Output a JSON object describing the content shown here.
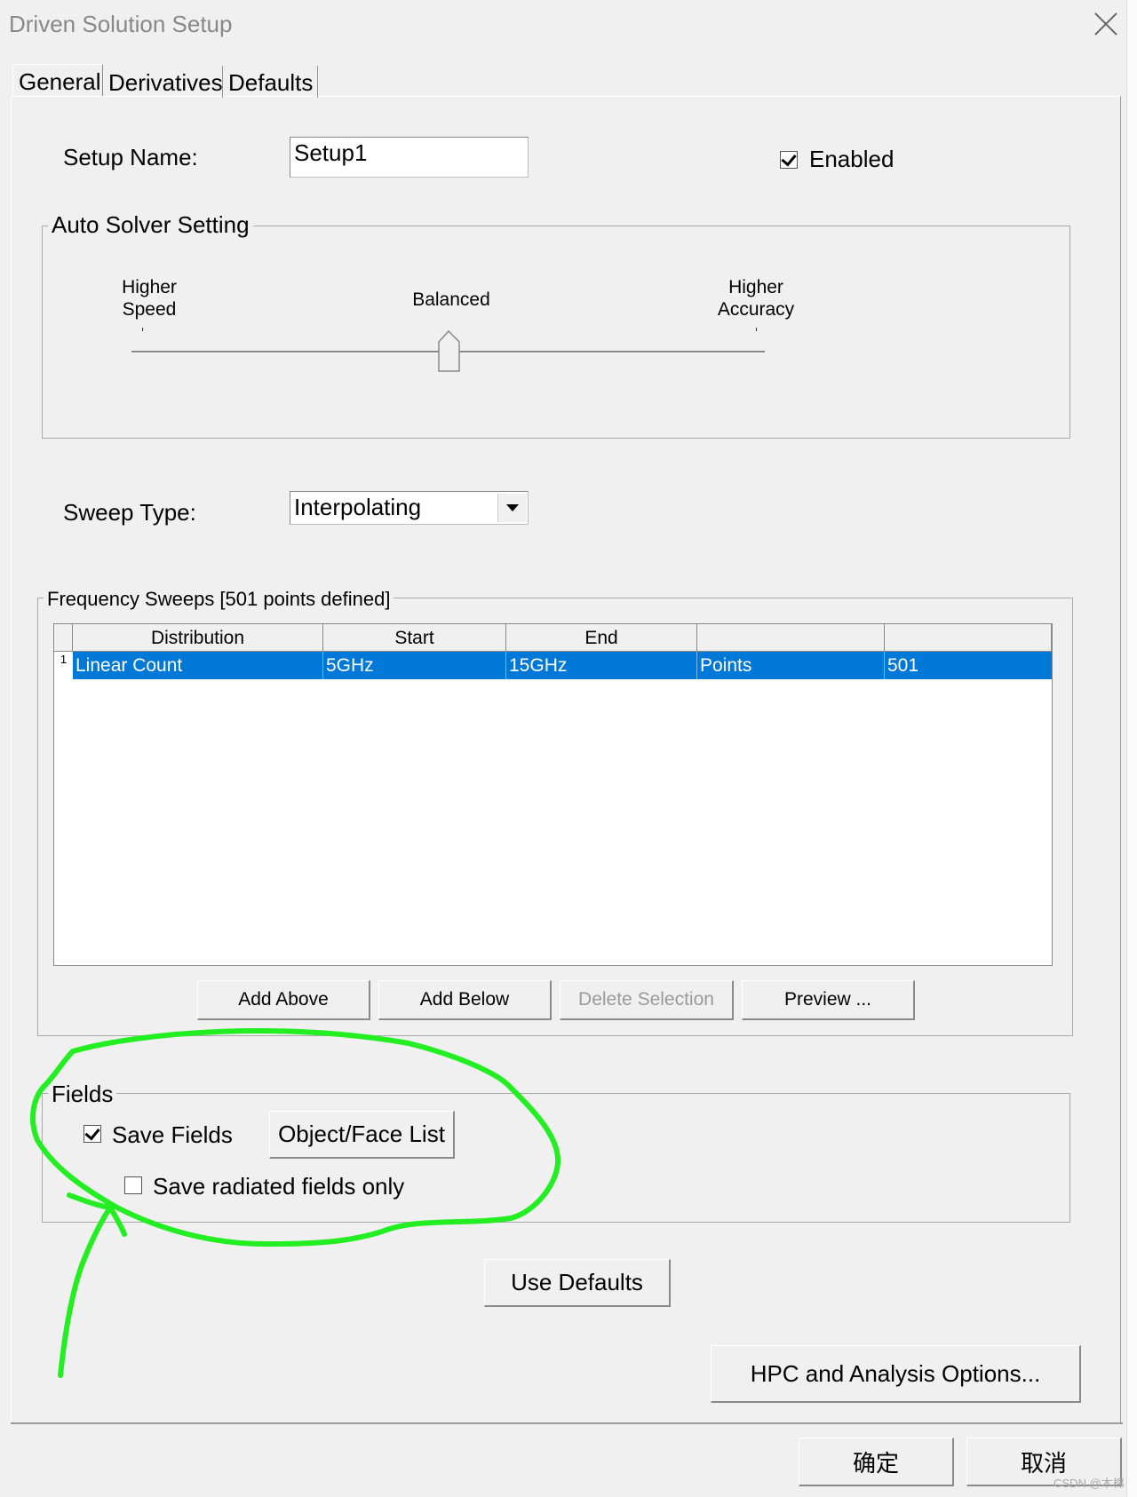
{
  "window": {
    "title": "Driven Solution Setup"
  },
  "tabs": [
    {
      "label": "General",
      "active": true
    },
    {
      "label": "Derivatives",
      "active": false
    },
    {
      "label": "Defaults",
      "active": false
    }
  ],
  "setup_name": {
    "label": "Setup Name:",
    "value": "Setup1"
  },
  "enabled": {
    "label": "Enabled",
    "checked": true
  },
  "auto_solver": {
    "title": "Auto Solver Setting",
    "left_label": "Higher\nSpeed",
    "middle_label": "Balanced",
    "right_label": "Higher\nAccuracy",
    "slider_value": 0.5
  },
  "sweep_type": {
    "label": "Sweep Type:",
    "value": "Interpolating"
  },
  "frequency_sweeps": {
    "title": "Frequency Sweeps [501 points defined]",
    "columns": [
      "Distribution",
      "Start",
      "End",
      "",
      ""
    ],
    "rows": [
      {
        "index": "1",
        "distribution": "Linear Count",
        "start": "5GHz",
        "end": "15GHz",
        "type": "Points",
        "count": "501"
      }
    ],
    "buttons": {
      "add_above": "Add Above",
      "add_below": "Add Below",
      "delete_selection": "Delete Selection",
      "preview": "Preview ..."
    }
  },
  "fields": {
    "title": "Fields",
    "save_fields": {
      "label": "Save Fields",
      "checked": true
    },
    "object_face_list": "Object/Face List",
    "save_radiated": {
      "label": "Save radiated fields only",
      "checked": false
    }
  },
  "use_defaults": "Use Defaults",
  "hpc_options": "HPC and Analysis Options...",
  "ok_button": "确定",
  "cancel_button": "取消",
  "watermark": "CSDN @木棉",
  "annotation_color": "#22ee22"
}
